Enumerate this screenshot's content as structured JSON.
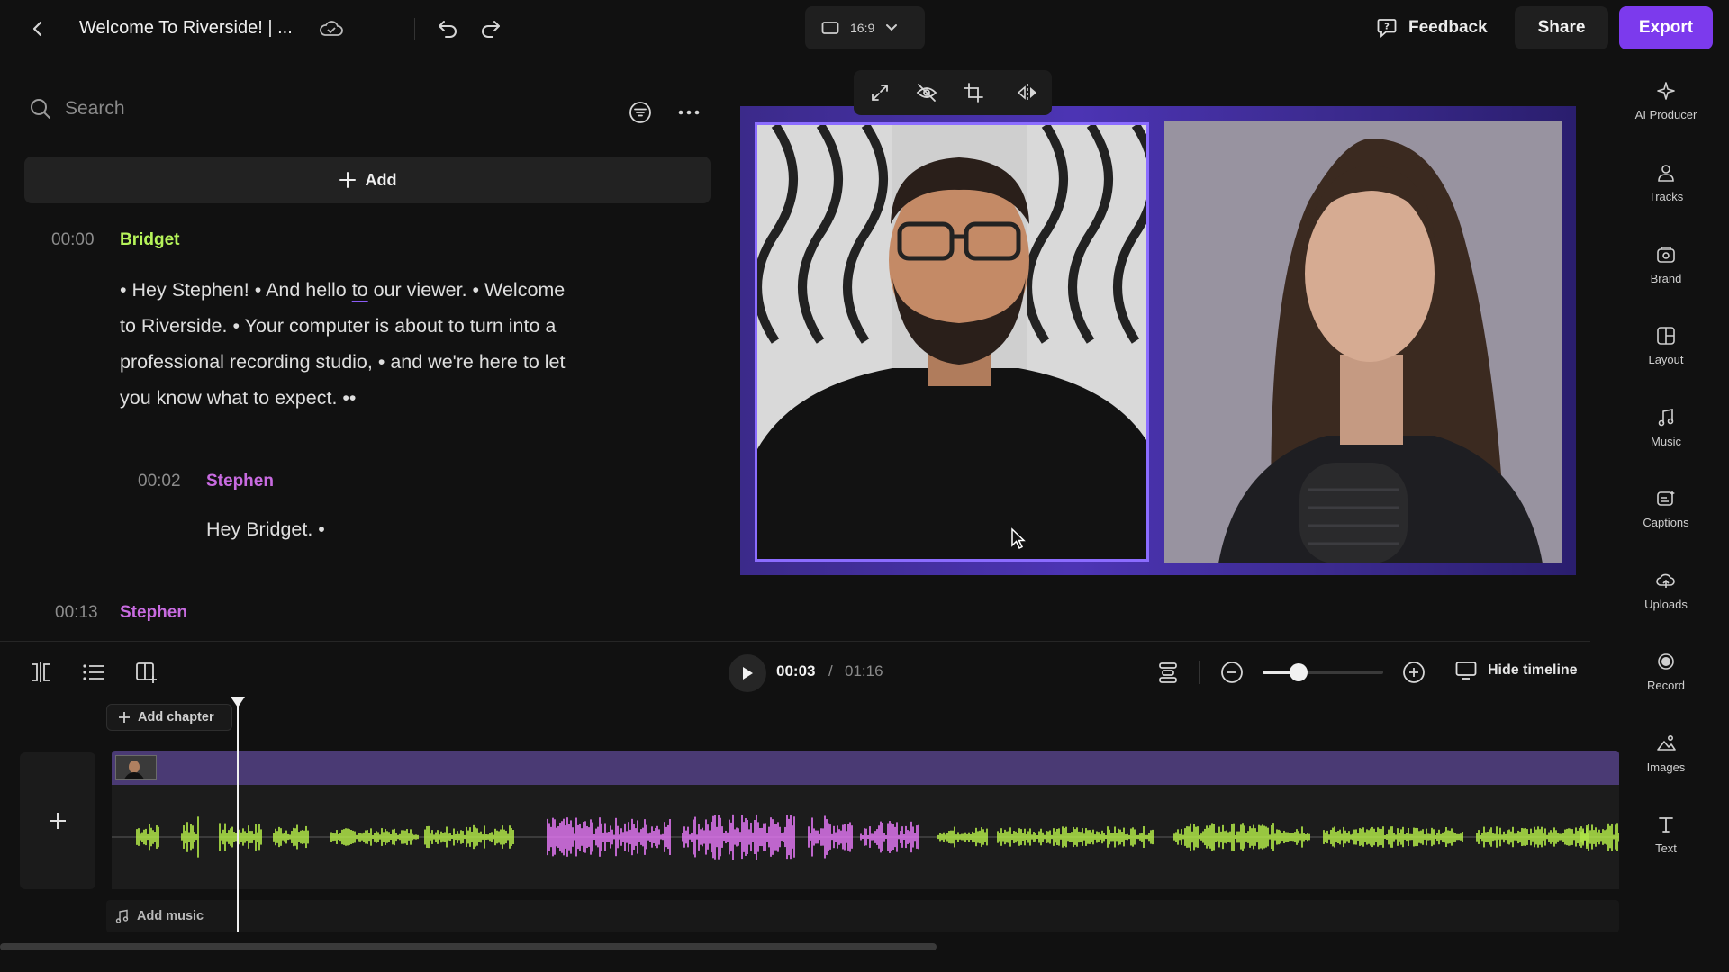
{
  "header": {
    "title": "Welcome To Riverside! | ...",
    "aspect_ratio": "16:9",
    "feedback_label": "Feedback",
    "share_label": "Share",
    "export_label": "Export"
  },
  "transcript": {
    "search_placeholder": "Search",
    "add_label": "Add",
    "entries": [
      {
        "time": "00:00",
        "speaker": "Bridget",
        "speaker_color": "#b6f45a",
        "lines": [
          "• Hey Stephen! • And hello ",
          "to",
          " our viewer. • Welcome",
          "to Riverside. • Your computer is about to turn into a",
          "professional recording studio, • and we're here to let",
          "you know what to expect. ••"
        ]
      },
      {
        "time": "00:02",
        "speaker": "Stephen",
        "speaker_color": "#c86be0",
        "lines": [
          "Hey Bridget. •"
        ]
      },
      {
        "time": "00:13",
        "speaker": "Stephen",
        "speaker_color": "#c86be0"
      }
    ]
  },
  "rail": {
    "items": [
      {
        "label": "AI Producer",
        "icon": "sparkle-icon"
      },
      {
        "label": "Tracks",
        "icon": "users-icon"
      },
      {
        "label": "Brand",
        "icon": "brand-icon"
      },
      {
        "label": "Layout",
        "icon": "layout-icon"
      },
      {
        "label": "Music",
        "icon": "music-note-icon"
      },
      {
        "label": "Captions",
        "icon": "captions-icon"
      },
      {
        "label": "Uploads",
        "icon": "upload-icon"
      },
      {
        "label": "Record",
        "icon": "record-icon"
      },
      {
        "label": "Images",
        "icon": "images-icon"
      },
      {
        "label": "Text",
        "icon": "text-icon"
      }
    ]
  },
  "timeline": {
    "current_time": "00:03",
    "separator": "/",
    "total_time": "01:16",
    "hide_label": "Hide timeline",
    "add_chapter_label": "Add chapter",
    "add_music_label": "Add music",
    "zoom_level_fraction": 0.3
  },
  "colors": {
    "accent": "#7c3aed",
    "wave_green": "#b8f04a",
    "wave_pink": "#e879f9"
  }
}
